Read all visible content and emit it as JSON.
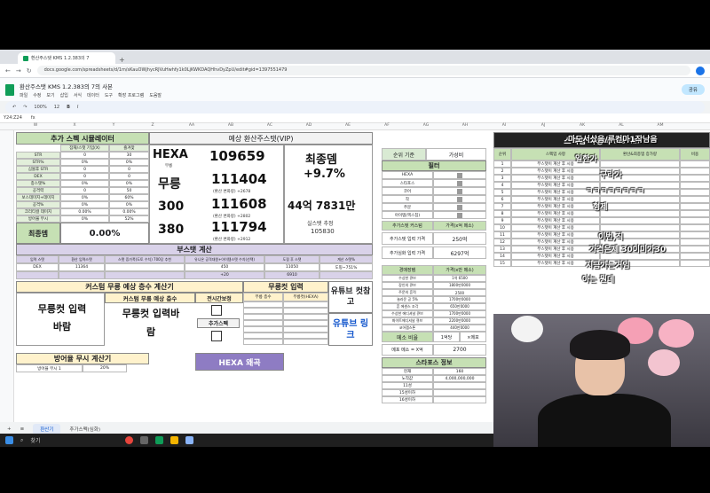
{
  "browser": {
    "tab_title": "환산주스탯 KMS 1.2.383의 7",
    "url": "docs.google.com/spreadsheets/d/1m/sKauOWjhycRJVuHwhfy1k0LjKWKDAQHhvDyZpU/edit#gid=1397551479"
  },
  "sheet": {
    "title": "환산주스탯 KMS 1.2.383의 7의 사본",
    "menus": [
      "파일",
      "수정",
      "보기",
      "삽입",
      "서식",
      "데이터",
      "도구",
      "확장 프로그램",
      "도움말"
    ],
    "share": "공유",
    "cell_ref": "Y24:Z24",
    "zoom": "100%",
    "font_size": "12",
    "columns": [
      "W",
      "X",
      "Y",
      "Z",
      "AA",
      "AB",
      "AC",
      "AD",
      "AE",
      "AF",
      "AG",
      "AH",
      "AI",
      "AJ",
      "AK",
      "AL",
      "AM"
    ],
    "tabs": [
      "환산기",
      "추가스펙(심화)"
    ]
  },
  "sim": {
    "title": "추가 스펙 시뮬레이터",
    "col_headers": [
      "잠재/스탯 기입(X)",
      "즐겨찾"
    ],
    "rows": [
      {
        "label": "STR",
        "a": "0",
        "b": "30"
      },
      {
        "label": "STR%",
        "a": "0%",
        "b": "0%"
      },
      {
        "label": "심볼후 STR",
        "a": "0",
        "b": "0"
      },
      {
        "label": "DEX",
        "a": "0",
        "b": "0"
      },
      {
        "label": "종스탯%",
        "a": "0%",
        "b": "0%"
      },
      {
        "label": "공격력",
        "a": "0",
        "b": "50"
      },
      {
        "label": "보스데미지+데미지",
        "a": "0%",
        "b": "60%"
      },
      {
        "label": "공격%",
        "a": "0%",
        "b": "0%"
      },
      {
        "label": "크리티컬 데미지",
        "a": "0.00%",
        "b": "0.00%"
      },
      {
        "label": "방어율 무시",
        "a": "0%",
        "b": "52%"
      }
    ],
    "final_label": "최종뎀",
    "final_value": "0.00%"
  },
  "vip": {
    "title": "예상 환산주스탯(VIP)",
    "hexa_label": "HEXA",
    "hexa_sub": "무릉",
    "hexa_value": "109659",
    "mureung_label": "무릉",
    "mureung_value": "111404",
    "mureung_sub": "(환산 변화량) +2678",
    "v300_label": "300",
    "v300_value": "111608",
    "v300_sub": "(환산 변화량) +2802",
    "v380_label": "380",
    "v380_value": "111794",
    "v380_sub": "(환산 변화량) +2912",
    "final_dmg_label": "최종뎀",
    "final_dmg_value": "+9.7%",
    "total_value": "44억 7831만",
    "real_stat_label": "실스탯 추정",
    "real_stat_value": "105830"
  },
  "boost": {
    "title": "부스탯 계산",
    "headers": [
      "입력 스탯",
      "환산 입력스탯",
      "스탯 증가폭(도토 수치) 700당 추천",
      "유니온 공격대원+아이템스탯 수치(선택)",
      "도핑 후 스탯",
      "계산 스탯%"
    ],
    "row": [
      "DEX",
      "11364",
      "",
      "450",
      "11050",
      "도핑~751%"
    ],
    "row2": [
      "",
      "",
      "",
      "+20",
      "6910",
      ""
    ]
  },
  "mureung": {
    "title": "커스텀 무릉 예상 층수 계산기",
    "left_label": "무릉컷 입력바람",
    "sub_title": "커스텀 무릉 예상 층수",
    "center_label": "무릉컷 입력바람",
    "check_label": "전시간보정",
    "extra_spec": "추가스펙",
    "cut_title": "무릉컷 입력",
    "cut_headers": [
      "무릉 층수",
      "무릉컷(HEXA)"
    ],
    "youtube_title": "유튜브 컷참고",
    "youtube_link": "유튜브 링크",
    "hexa_button": "HEXA 왜곡"
  },
  "defense": {
    "title": "방어율 무시 계산기",
    "label": "방어율 무시 1",
    "value": "20%"
  },
  "price": {
    "headers": [
      "순위 기준",
      "가성비"
    ],
    "filter": "필터",
    "items": [
      "HEXA",
      "스타포스",
      "코어",
      "작",
      "주문",
      "아이템(엑스칩)"
    ],
    "cutsom_header": [
      "추가스텟 커스텀",
      "가격(x억 메소)"
    ],
    "rows": [
      {
        "label": "추가스텟 입력 가격",
        "value": "250억"
      },
      {
        "label": "추가심화 입력 가격",
        "value": "6297억"
      }
    ],
    "exp_header": [
      "경매장템",
      "가격(x만 메소)"
    ],
    "exp_rows": [
      {
        "label": "수상한 큐브",
        "value": "1억 6500"
      },
      {
        "label": "장인의 큐브",
        "value": "1800만0000"
      },
      {
        "label": "주문의 흔적",
        "value": "2500"
      },
      {
        "label": "놀라운 공 5%",
        "value": "1700만0000"
      },
      {
        "label": "흔 에센스 조각",
        "value": "650만0000"
      },
      {
        "label": "수상한 에디셔널 큐브",
        "value": "1700만0000"
      },
      {
        "label": "화이트에디셔널 큐브",
        "value": "2200만0000"
      },
      {
        "label": "코어젬스톤",
        "value": "440만0000"
      }
    ],
    "meso_label": "메소 비율",
    "meso_value": "1억당",
    "meso_unit": "×메포",
    "meso_rate_label": "메포 메소 = X억",
    "meso_rate_value": "2700",
    "starforce_title": "스타포스 정보",
    "sf_rows": [
      {
        "label": "현재",
        "value": "160"
      },
      {
        "label": "노작값",
        "value": "4,000,000,000"
      },
      {
        "label": "11성",
        "value": ""
      },
      {
        "label": "15성이하",
        "value": ""
      },
      {
        "label": "16성이하",
        "value": ""
      }
    ]
  },
  "specup": {
    "title": "스펙업 가성비",
    "sub": "(예상 기준)",
    "headers": [
      "순위",
      "스펙업 사항",
      "환산&최종뎀 증가량",
      "비용"
    ],
    "ranks": [
      "1",
      "2",
      "3",
      "4",
      "5",
      "6",
      "7",
      "8",
      "9",
      "10",
      "11",
      "12",
      "13",
      "14",
      "15"
    ],
    "item_text": "부스탯이 계산 후 시용"
  },
  "chat": {
    "l1": "마도서샀음/루컨마1작남음",
    "l2": "일한가",
    "l3": "구라가",
    "l4": "ㅋㅋㅋㅋㅋㅋㅋㅋ",
    "l5": "형제",
    "l6": "이번,직",
    "l7": "가격은제 30이미가30",
    "l8": "지금가는거임",
    "l9": "아는 뭔데"
  },
  "taskbar": {
    "search": "찾기"
  }
}
